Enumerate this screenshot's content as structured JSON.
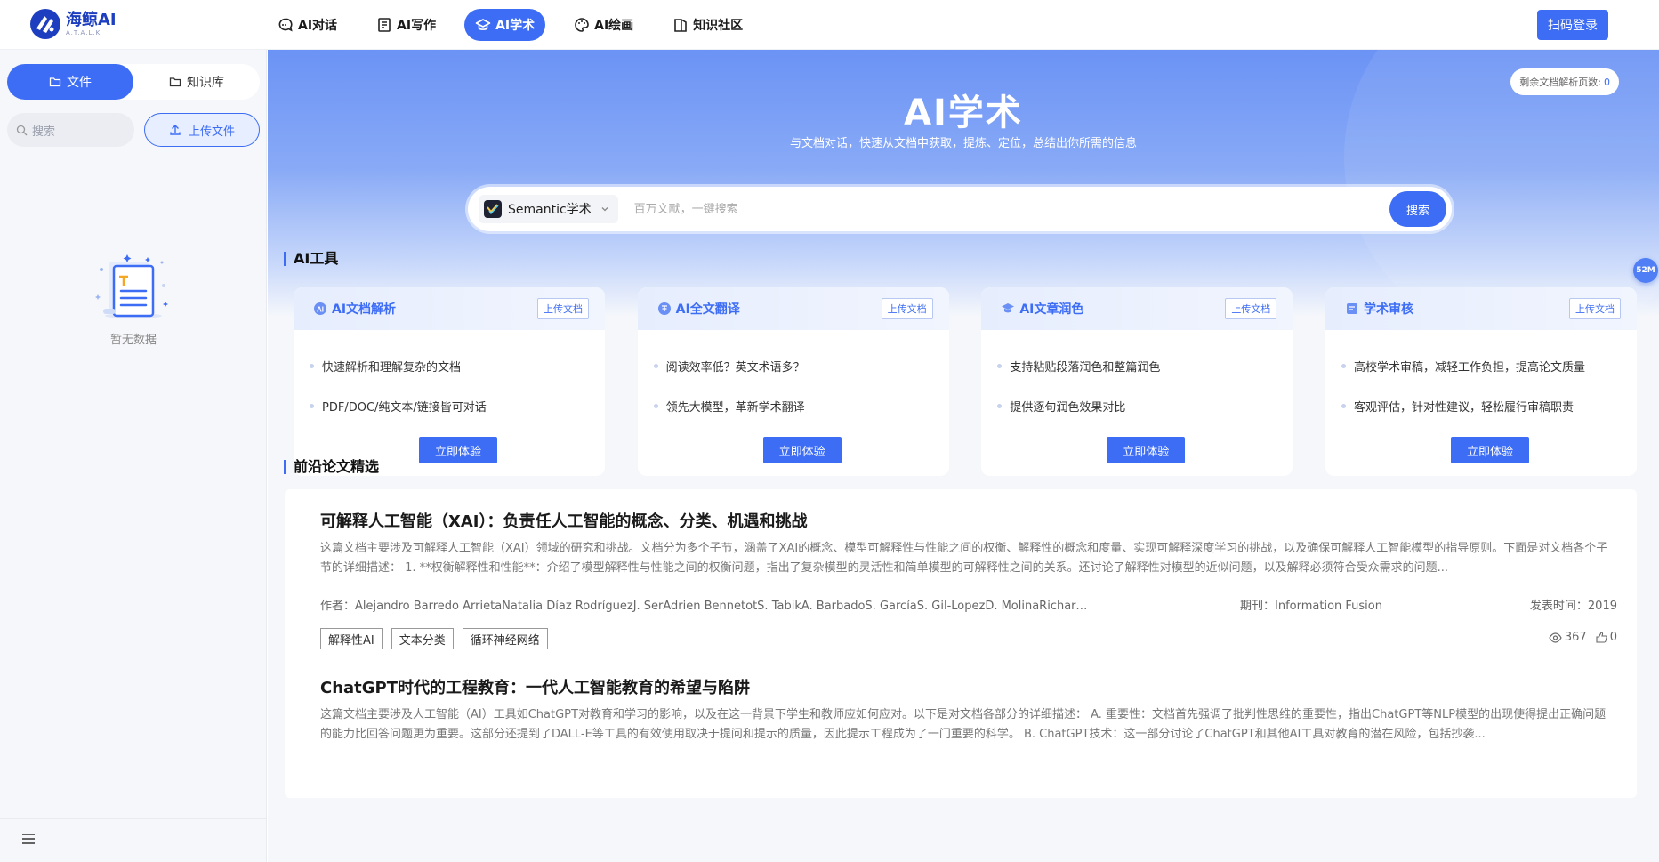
{
  "brand": {
    "name": "海鲸AI",
    "sub": "A.T.A.L.K"
  },
  "nav": {
    "items": [
      {
        "label": "AI对话",
        "icon": "chat-icon"
      },
      {
        "label": "AI写作",
        "icon": "write-icon"
      },
      {
        "label": "AI学术",
        "icon": "academic-cap-icon",
        "active": true
      },
      {
        "label": "AI绘画",
        "icon": "palette-icon"
      },
      {
        "label": "知识社区",
        "icon": "book-icon"
      }
    ],
    "login_label": "扫码登录"
  },
  "sidebar": {
    "tabs": [
      {
        "label": "文件",
        "active": true
      },
      {
        "label": "知识库",
        "active": false
      }
    ],
    "search_placeholder": "搜索",
    "upload_label": "上传文件",
    "empty_text": "暂无数据"
  },
  "hero": {
    "title": "AI学术",
    "subtitle": "与文档对话，快速从文档中获取，提炼、定位，总结出你所需的信息",
    "quota_label": "剩余文档解析页数:",
    "quota_value": "0",
    "source_label": "Semantic学术",
    "search_placeholder": "百万文献，一键搜索",
    "search_button": "搜索"
  },
  "tools": {
    "section_title": "AI工具",
    "cards": [
      {
        "name": "AI文档解析",
        "icon": "ai-doc-icon",
        "tag": "上传文档",
        "points": [
          "快速解析和理解复杂的文档",
          "PDF/DOC/纯文本/链接皆可对话"
        ],
        "button": "立即体验"
      },
      {
        "name": "AI全文翻译",
        "icon": "translate-icon",
        "tag": "上传文档",
        "points": [
          "阅读效率低？英文术语多？",
          "领先大模型，革新学术翻译"
        ],
        "button": "立即体验"
      },
      {
        "name": "AI文章润色",
        "icon": "graduation-cap-icon",
        "tag": "上传文档",
        "points": [
          "支持粘贴段落润色和整篇润色",
          "提供逐句润色效果对比"
        ],
        "button": "立即体验"
      },
      {
        "name": "学术审核",
        "icon": "review-icon",
        "tag": "上传文档",
        "points": [
          "高校学术审稿，减轻工作负担，提高论文质量",
          "客观评估，针对性建议，轻松履行审稿职责"
        ],
        "button": "立即体验"
      }
    ]
  },
  "papers": {
    "section_title": "前沿论文精选",
    "items": [
      {
        "title": "可解释人工智能（XAI）：负责任人工智能的概念、分类、机遇和挑战",
        "abstract": "这篇文档主要涉及可解释人工智能（XAI）领域的研究和挑战。文档分为多个子节，涵盖了XAI的概念、模型可解释性与性能之间的权衡、解释性的概念和度量、实现可解释深度学习的挑战，以及确保可解释人工智能模型的指导原则。下面是对文档各个子节的详细描述： 1. **权衡解释性和性能**：介绍了模型解释性与性能之间的权衡问题，指出了复杂模型的灵活性和简单模型的可解释性之间的关系。还讨论了解释性对模型的近似问题，以及解释必须符合受众需求的问题...",
        "authors_label": "作者：",
        "authors": "Alejandro Barredo ArrietaNatalia Díaz RodríguezJ. SerAdrien BennetotS. TabikA. BarbadoS. GarcíaS. Gil-LopezD. MolinaRichard Benjamins",
        "journal_label": "期刊：",
        "journal": "Information Fusion",
        "date_label": "发表时间：",
        "date": "2019",
        "tags": [
          "解释性AI",
          "文本分类",
          "循环神经网络"
        ],
        "views": "367",
        "likes": "0"
      },
      {
        "title": "ChatGPT时代的工程教育：一代人工智能教育的希望与陷阱",
        "abstract": "这篇文档主要涉及人工智能（AI）工具如ChatGPT对教育和学习的影响，以及在这一背景下学生和教师应如何应对。以下是对文档各部分的详细描述： A. 重要性：文档首先强调了批判性思维的重要性，指出ChatGPT等NLP模型的出现使得提出正确问题的能力比回答问题更为重要。这部分还提到了DALL-E等工具的有效使用取决于提问和提示的质量，因此提示工程成为了一门重要的科学。 B. ChatGPT技术：这一部分讨论了ChatGPT和其他AI工具对教育的潜在风险，包括抄袭..."
      }
    ]
  },
  "float_badge": "52M",
  "colors": {
    "accent": "#3d6df5",
    "brand": "#1d3fbf"
  }
}
